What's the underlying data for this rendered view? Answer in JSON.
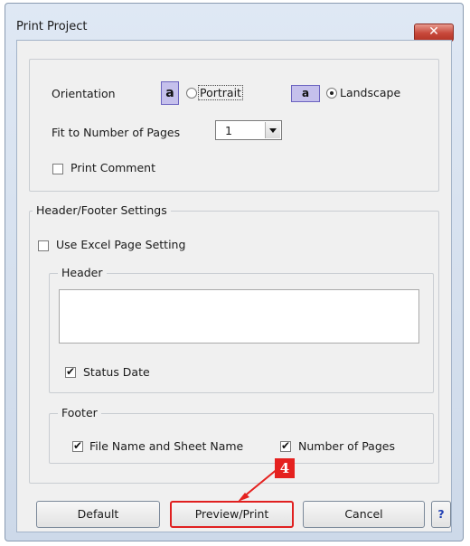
{
  "window": {
    "title": "Print Project",
    "close_glyph": "✕"
  },
  "options": {
    "orientation_label": "Orientation",
    "icon_letter": "a",
    "portrait_label": "Portrait",
    "landscape_label": "Landscape",
    "selected_orientation": "Landscape",
    "fit_pages_label": "Fit to Number of Pages",
    "fit_pages_value": "1",
    "print_comment_label": "Print Comment",
    "print_comment_checked": false
  },
  "header_footer": {
    "legend": "Header/Footer Settings",
    "use_excel_label": "Use Excel Page Setting",
    "use_excel_checked": false,
    "header": {
      "legend": "Header",
      "text_value": "",
      "status_date_label": "Status Date",
      "status_date_checked": true
    },
    "footer": {
      "legend": "Footer",
      "file_sheet_label": "File Name and Sheet Name",
      "file_sheet_checked": true,
      "pages_label": "Number of Pages",
      "pages_checked": true
    }
  },
  "buttons": {
    "default": "Default",
    "preview_print": "Preview/Print",
    "cancel": "Cancel",
    "help": "?"
  },
  "annotation": {
    "step_number": "4",
    "color": "#e5211f"
  }
}
